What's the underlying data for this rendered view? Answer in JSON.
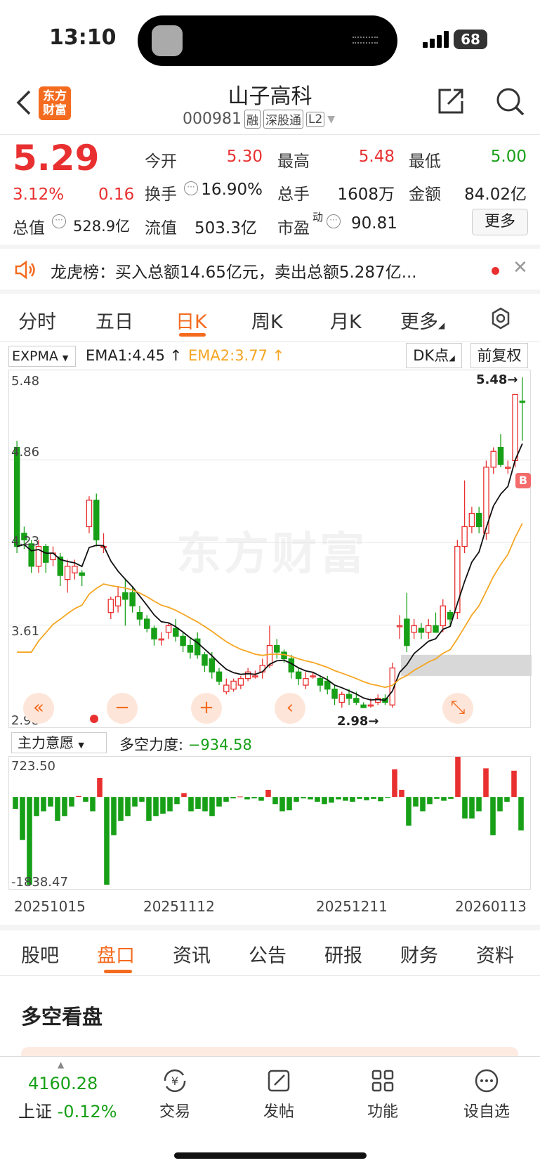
{
  "status": {
    "time": "13:10",
    "battery": "68"
  },
  "header": {
    "title": "山子高科",
    "code": "000981",
    "tags": [
      "融",
      "深股通",
      "L2"
    ],
    "logo_text": "东方财富"
  },
  "quote": {
    "price": "5.29",
    "pct": "3.12%",
    "change": "0.16",
    "rows": [
      [
        {
          "label": "今开",
          "value": "5.30",
          "color": "red"
        },
        {
          "label": "最高",
          "value": "5.48",
          "color": "red"
        },
        {
          "label": "最低",
          "value": "5.00",
          "color": "green"
        }
      ],
      [
        {
          "label": "换手",
          "value": "16.90%",
          "color": ""
        },
        {
          "label": "总手",
          "value": "1608万",
          "color": ""
        },
        {
          "label": "金额",
          "value": "84.02亿",
          "color": ""
        }
      ]
    ],
    "total_cap_label": "总值",
    "total_cap": "528.9亿",
    "float_cap_label": "流值",
    "float_cap": "503.3亿",
    "pe_label": "市盈",
    "pe_sup": "动",
    "pe": "90.81",
    "more_label": "更多"
  },
  "notice": {
    "text": "龙虎榜：买入总额14.65亿元，卖出总额5.287亿..."
  },
  "chart_tabs": {
    "items": [
      "分时",
      "五日",
      "日K",
      "周K",
      "月K",
      "更多"
    ],
    "active": 2
  },
  "chart_toolbar": {
    "indicator": "EXPMA",
    "ema1": "EMA1:4.45",
    "ema2": "EMA2:3.77",
    "dk": "DK点",
    "fq": "前复权"
  },
  "chart_data": {
    "type": "candlestick",
    "watermark": "东方财富",
    "y_ticks": [
      "5.48",
      "4.86",
      "4.23",
      "3.61",
      "2.98"
    ],
    "ylim": [
      2.98,
      5.48
    ],
    "max_marker": "5.48",
    "min_marker": "2.98",
    "b_marker": "B",
    "candles": [
      [
        4.95,
        4.2,
        5.0,
        4.15
      ],
      [
        4.3,
        4.25,
        4.35,
        4.18
      ],
      [
        4.22,
        4.05,
        4.25,
        4.0
      ],
      [
        4.05,
        4.2,
        4.25,
        4.0
      ],
      [
        4.2,
        4.08,
        4.22,
        4.0
      ],
      [
        4.1,
        4.15,
        4.2,
        4.05
      ],
      [
        4.12,
        3.98,
        4.15,
        3.9
      ],
      [
        3.95,
        4.05,
        4.1,
        3.85
      ],
      [
        4.0,
        4.05,
        4.1,
        3.95
      ],
      [
        4.0,
        3.98,
        4.02,
        3.9
      ],
      [
        4.35,
        4.55,
        4.58,
        4.3
      ],
      [
        4.55,
        4.25,
        4.6,
        4.2
      ],
      [
        4.2,
        4.2,
        4.3,
        4.15
      ],
      [
        3.7,
        3.8,
        3.82,
        3.65
      ],
      [
        3.75,
        3.82,
        3.9,
        3.7
      ],
      [
        3.85,
        3.8,
        3.95,
        3.6
      ],
      [
        3.85,
        3.75,
        3.9,
        3.7
      ],
      [
        3.7,
        3.65,
        3.75,
        3.6
      ],
      [
        3.65,
        3.58,
        3.68,
        3.55
      ],
      [
        3.58,
        3.5,
        3.6,
        3.45
      ],
      [
        3.5,
        3.5,
        3.55,
        3.45
      ],
      [
        3.55,
        3.6,
        3.62,
        3.5
      ],
      [
        3.58,
        3.52,
        3.65,
        3.48
      ],
      [
        3.52,
        3.45,
        3.55,
        3.4
      ],
      [
        3.45,
        3.4,
        3.5,
        3.35
      ],
      [
        3.5,
        3.38,
        3.55,
        3.35
      ],
      [
        3.38,
        3.3,
        3.4,
        3.25
      ],
      [
        3.35,
        3.25,
        3.4,
        3.2
      ],
      [
        3.25,
        3.18,
        3.28,
        3.15
      ],
      [
        3.1,
        3.15,
        3.2,
        3.08
      ],
      [
        3.12,
        3.18,
        3.2,
        3.1
      ],
      [
        3.15,
        3.2,
        3.22,
        3.12
      ],
      [
        3.2,
        3.25,
        3.28,
        3.18
      ],
      [
        3.22,
        3.22,
        3.26,
        3.2
      ],
      [
        3.25,
        3.3,
        3.35,
        3.2
      ],
      [
        3.3,
        3.45,
        3.6,
        3.28
      ],
      [
        3.45,
        3.4,
        3.5,
        3.35
      ],
      [
        3.4,
        3.35,
        3.42,
        3.32
      ],
      [
        3.35,
        3.25,
        3.38,
        3.2
      ],
      [
        3.25,
        3.2,
        3.28,
        3.15
      ],
      [
        3.15,
        3.2,
        3.25,
        3.12
      ],
      [
        3.22,
        3.22,
        3.25,
        3.2
      ],
      [
        3.2,
        3.15,
        3.22,
        3.1
      ],
      [
        3.18,
        3.12,
        3.22,
        3.08
      ],
      [
        3.12,
        3.05,
        3.15,
        3.0
      ],
      [
        3.02,
        3.08,
        3.1,
        2.98
      ],
      [
        3.08,
        3.05,
        3.12,
        3.0
      ],
      [
        3.05,
        3.02,
        3.1,
        3.0
      ],
      [
        3.0,
        2.98,
        3.02,
        2.98
      ],
      [
        3.0,
        3.0,
        3.05,
        2.98
      ],
      [
        3.02,
        3.05,
        3.08,
        3.0
      ],
      [
        3.05,
        3.02,
        3.08,
        3.0
      ],
      [
        3.0,
        3.28,
        3.32,
        2.98
      ],
      [
        3.6,
        3.6,
        3.68,
        3.5
      ],
      [
        3.65,
        3.45,
        3.85,
        3.4
      ],
      [
        3.55,
        3.6,
        3.65,
        3.5
      ],
      [
        3.58,
        3.55,
        3.62,
        3.5
      ],
      [
        3.55,
        3.6,
        3.65,
        3.5
      ],
      [
        3.6,
        3.55,
        3.7,
        3.55
      ],
      [
        3.6,
        3.75,
        3.8,
        3.55
      ],
      [
        3.7,
        3.65,
        3.72,
        3.6
      ],
      [
        3.7,
        4.2,
        4.25,
        3.65
      ],
      [
        4.2,
        4.35,
        4.7,
        4.15
      ],
      [
        4.35,
        4.45,
        4.5,
        4.3
      ],
      [
        4.45,
        4.35,
        4.5,
        4.3
      ],
      [
        4.3,
        4.8,
        4.85,
        4.25
      ],
      [
        4.8,
        4.92,
        4.95,
        4.75
      ],
      [
        4.95,
        4.82,
        5.05,
        4.8
      ],
      [
        4.8,
        4.8,
        4.85,
        4.75
      ],
      [
        4.85,
        5.35,
        5.35,
        4.8
      ],
      [
        5.3,
        5.29,
        5.48,
        5.0
      ]
    ]
  },
  "sub_chart": {
    "indicator": "主力意愿",
    "label": "多空力度:",
    "value": "−934.58",
    "top_tick": "723.50",
    "bottom_tick": "-1838.47",
    "values": [
      -250,
      -900,
      -1838,
      -400,
      -300,
      -200,
      -500,
      -400,
      -200,
      20,
      -100,
      -300,
      400,
      -1838,
      -800,
      -500,
      -400,
      -200,
      -100,
      -500,
      -400,
      -350,
      -300,
      -150,
      80,
      -300,
      -250,
      -300,
      -400,
      -200,
      -100,
      -30,
      10,
      -50,
      -30,
      -80,
      150,
      -150,
      -300,
      -280,
      -100,
      -30,
      -50,
      -100,
      -150,
      -120,
      -50,
      -80,
      -100,
      -40,
      -70,
      -40,
      -90,
      -20,
      580,
      150,
      -600,
      -200,
      -300,
      -150,
      -40,
      -80,
      -40,
      850,
      -450,
      -450,
      -300,
      600,
      -800,
      -300,
      -100,
      550,
      -700
    ]
  },
  "dates": [
    "20251015",
    "20251112",
    "20251211",
    "20260113"
  ],
  "footer_tabs": {
    "items": [
      "股吧",
      "盘口",
      "资讯",
      "公告",
      "研报",
      "财务",
      "资料"
    ],
    "active": 1
  },
  "section": {
    "title": "多空看盘"
  },
  "bottom_nav": {
    "index_value": "4160.28",
    "index_label": "上证",
    "index_change": "-0.12%",
    "items": [
      {
        "label": "交易",
        "icon": "trade-icon"
      },
      {
        "label": "发帖",
        "icon": "compose-icon"
      },
      {
        "label": "功能",
        "icon": "grid-icon"
      },
      {
        "label": "设自选",
        "icon": "more-dots-icon"
      }
    ]
  }
}
